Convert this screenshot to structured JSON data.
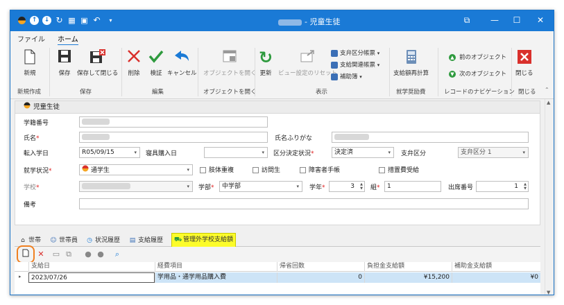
{
  "window": {
    "title_suffix": "- 児童生徒",
    "tb_icons": [
      "app-icon",
      "upload-icon",
      "download-icon",
      "refresh-icon",
      "grid-icon",
      "save-icon",
      "undo-icon",
      "dropdown-icon"
    ],
    "controls": {
      "restore": "⧉",
      "minimize": "—",
      "maximize": "☐",
      "close": "✕"
    }
  },
  "menu": {
    "file": "ファイル",
    "home": "ホーム"
  },
  "ribbon": {
    "new": "新規",
    "save": "保存",
    "save_close": "保存して閉じる",
    "delete": "削除",
    "verify": "検証",
    "cancel": "キャンセル",
    "open_object": "オブジェクトを開く",
    "refresh": "更新",
    "view_reset": "ビュー設定のリセット",
    "payment_ledger": "支弁区分帳票",
    "payment_related": "支給関連帳票",
    "aux_ledger": "補助簿",
    "recalc": "支給額再計算",
    "prev_obj": "前のオブジェクト",
    "next_obj": "次のオブジェクト",
    "close": "閉じる",
    "groups": {
      "new": "新規作成",
      "save": "保存",
      "edit": "編集",
      "open": "オブジェクトを開く",
      "display": "表示",
      "aid": "就学奨励費",
      "nav": "レコードのナビゲーション",
      "close": "閉じる"
    }
  },
  "panel": {
    "title": "児童生徒"
  },
  "form": {
    "gakuseki_label": "学籍番号",
    "name_label": "氏名",
    "kana_label": "氏名ふりがな",
    "transfer_label": "転入学日",
    "transfer_value": "R05/09/15",
    "commute_label": "寝具購入日",
    "decision_label": "区分決定状況",
    "decision_value": "決定済",
    "kubun_label": "支弁区分",
    "kubun_value": "支弁区分 1",
    "status_label": "就学状況",
    "status_value": "通学生",
    "cb1": "肢体重複",
    "cb2": "訪問生",
    "cb3": "障害者手帳",
    "cb4": "措置費受給",
    "school_label": "学校",
    "dept_label": "学部",
    "dept_value": "中学部",
    "grade_label": "学年",
    "grade_value": "3",
    "class_label": "組",
    "class_value": "1",
    "seat_label": "出席番号",
    "seat_value": "1",
    "notes_label": "備考"
  },
  "tabs": [
    "世帯",
    "世帯員",
    "状況履歴",
    "支給履歴",
    "管理外学校支給額"
  ],
  "tab_icons": [
    "house-icon",
    "people-icon",
    "clock-icon",
    "wallet-icon",
    "car-money-icon"
  ],
  "grid": {
    "columns": [
      "支給日",
      "経費項目",
      "帰省回数",
      "負担金支給額",
      "補助金支給額"
    ],
    "row": {
      "date": "2023/07/26",
      "item": "学用品・通学用品購入費",
      "count": "0",
      "burden": "¥15,200",
      "subsidy": "¥0"
    }
  },
  "colors": {
    "accent": "#1a7ad6",
    "tab_highlight": "#fcfc2a",
    "focus_outline": "#f08020",
    "required": "#e02020"
  }
}
